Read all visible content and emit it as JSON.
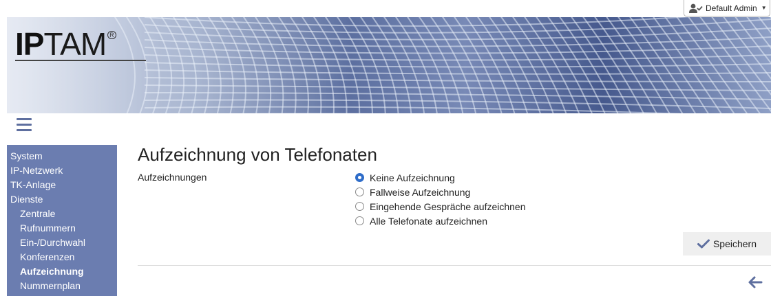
{
  "user_menu": {
    "label": "Default Admin",
    "icon": "user-check-icon",
    "caret_icon": "caret-down-icon"
  },
  "logo": {
    "text_bold": "IP",
    "text_thin": "TAM",
    "reg_mark": "R"
  },
  "sidebar": {
    "items": [
      {
        "label": "System",
        "level": 0,
        "active": false
      },
      {
        "label": "IP-Netzwerk",
        "level": 0,
        "active": false
      },
      {
        "label": "TK-Anlage",
        "level": 0,
        "active": false
      },
      {
        "label": "Dienste",
        "level": 0,
        "active": false
      },
      {
        "label": "Zentrale",
        "level": 1,
        "active": false
      },
      {
        "label": "Rufnummern",
        "level": 1,
        "active": false
      },
      {
        "label": "Ein-/Durchwahl",
        "level": 1,
        "active": false
      },
      {
        "label": "Konferenzen",
        "level": 1,
        "active": false
      },
      {
        "label": "Aufzeichnung",
        "level": 1,
        "active": true
      },
      {
        "label": "Nummernplan",
        "level": 1,
        "active": false
      }
    ]
  },
  "main": {
    "title": "Aufzeichnung von Telefonaten",
    "field_label": "Aufzeichnungen",
    "options": [
      {
        "label": "Keine Aufzeichnung",
        "checked": true
      },
      {
        "label": "Fallweise Aufzeichnung",
        "checked": false
      },
      {
        "label": "Eingehende Gespräche aufzeichnen",
        "checked": false
      },
      {
        "label": "Alle Telefonate aufzeichnen",
        "checked": false
      }
    ],
    "save_label": "Speichern"
  },
  "colors": {
    "sidebar_bg": "#6b7db0",
    "accent": "#5e6f9f",
    "radio_checked": "#2f6dc9"
  }
}
